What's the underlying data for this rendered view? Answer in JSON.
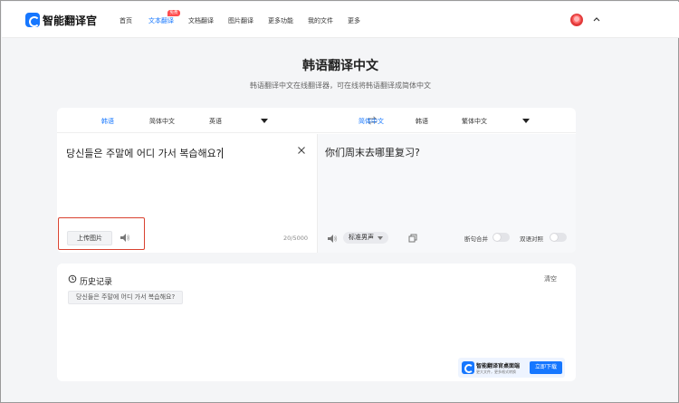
{
  "app": {
    "name": "智能翻译官"
  },
  "nav": {
    "items": [
      {
        "label": "首页"
      },
      {
        "label": "文本翻译"
      },
      {
        "label": "文档翻译"
      },
      {
        "label": "图片翻译"
      },
      {
        "label": "更多功能"
      },
      {
        "label": "我的文件"
      },
      {
        "label": "更多"
      }
    ],
    "active_index": 1,
    "badge": "免费"
  },
  "page": {
    "title": "韩语翻译中文",
    "subtitle": "韩语翻译中文在线翻译器，可在线将韩语翻译成简体中文"
  },
  "source_langs": [
    "韩语",
    "简体中文",
    "英语"
  ],
  "target_langs": [
    "简体中文",
    "韩语",
    "繁体中文"
  ],
  "source": {
    "text": "당신들은 주말에 어디 가서 복습해요?",
    "char_count": "20/5000",
    "upload_label": "上传图片"
  },
  "target": {
    "text": "你们周末去哪里复习?",
    "voice": "标准男声",
    "toggle_merge": "断句合并",
    "toggle_bilingual": "双语对照"
  },
  "history": {
    "title": "历史记录",
    "clear_label": "清空",
    "items": [
      "당신들은 주말에 어디 가서 복습해요?"
    ]
  },
  "promo": {
    "title": "智能翻译官桌面端",
    "subtitle": "更大文件，更多格式转换",
    "button": "立即下载"
  },
  "colors": {
    "accent": "#1677ff",
    "badge": "#ff4d4f",
    "highlight_border": "#d9412f"
  }
}
